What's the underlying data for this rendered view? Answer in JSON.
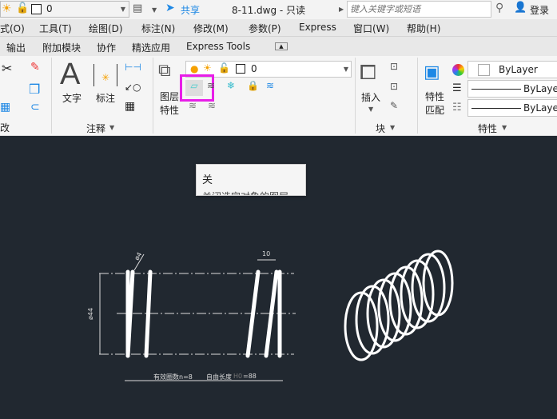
{
  "titlebar": {
    "layer_value": "0",
    "share": "共享",
    "doc_title": "8-11.dwg - 只读",
    "search_placeholder": "键入关键字或短语",
    "login": "登录"
  },
  "menu": [
    "式(O)",
    "工具(T)",
    "绘图(D)",
    "标注(N)",
    "修改(M)",
    "参数(P)",
    "Express",
    "窗口(W)",
    "帮助(H)"
  ],
  "tabs": [
    "输出",
    "附加模块",
    "协作",
    "精选应用",
    "Express Tools"
  ],
  "ribbon": {
    "annotation": {
      "text_label": "文字",
      "dim_label": "标注",
      "panel": "注释"
    },
    "layers": {
      "layer_props": "图层\n特性",
      "layer_value": "0"
    },
    "block": {
      "insert_label": "插入",
      "panel": "块"
    },
    "properties": {
      "match_label": "特性\n匹配",
      "color": "ByLayer",
      "linetype": "ByLayer",
      "lineweight": "ByLayer",
      "panel": "特性"
    },
    "left_panel_fragment": "改"
  },
  "tooltip": {
    "title": "关",
    "desc": "关闭选定对象的图层"
  },
  "drawing": {
    "dim_wire": "ø4",
    "dim_pitch": "10",
    "dim_dia": "ø44",
    "note_left": "有效圈数n=8",
    "note_right": "自由长度",
    "note_h0": "H0",
    "note_val": "=88"
  },
  "colors": {
    "highlight": "#e81ee8",
    "accent": "#1e88e5",
    "canvas": "#212830"
  }
}
